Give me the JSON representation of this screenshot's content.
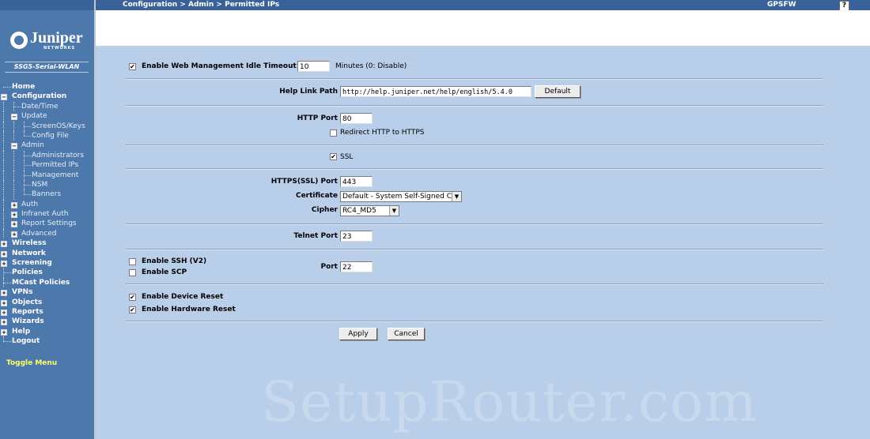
{
  "brand": {
    "logo_text": "Juniper",
    "logo_subtext": "NETWORKS",
    "device_name": "SSG5-Serial-WLAN"
  },
  "header": {
    "breadcrumb": "Configuration > Admin > Permitted IPs",
    "device_title": "GPSFW",
    "help_label": "?"
  },
  "nav": {
    "items": [
      {
        "label": "Home"
      },
      {
        "label": "Configuration"
      },
      {
        "label": "Date/Time"
      },
      {
        "label": "Update"
      },
      {
        "label": "ScreenOS/Keys"
      },
      {
        "label": "Config File"
      },
      {
        "label": "Admin"
      },
      {
        "label": "Administrators"
      },
      {
        "label": "Permitted IPs"
      },
      {
        "label": "Management"
      },
      {
        "label": "NSM"
      },
      {
        "label": "Banners"
      },
      {
        "label": "Auth"
      },
      {
        "label": "Infranet Auth"
      },
      {
        "label": "Report Settings"
      },
      {
        "label": "Advanced"
      },
      {
        "label": "Wireless"
      },
      {
        "label": "Network"
      },
      {
        "label": "Screening"
      },
      {
        "label": "Policies"
      },
      {
        "label": "MCast Policies"
      },
      {
        "label": "VPNs"
      },
      {
        "label": "Objects"
      },
      {
        "label": "Reports"
      },
      {
        "label": "Wizards"
      },
      {
        "label": "Help"
      },
      {
        "label": "Logout"
      }
    ],
    "toggle_menu": "Toggle Menu"
  },
  "form": {
    "idle_timeout": {
      "label": "Enable Web Management Idle Timeout",
      "checked": true,
      "value": "10",
      "unit": "Minutes (0: Disable)"
    },
    "help_link": {
      "label": "Help Link Path",
      "value": "http://help.juniper.net/help/english/5.4.0",
      "button": "Default"
    },
    "http_port": {
      "label": "HTTP Port",
      "value": "80",
      "redirect_label": "Redirect HTTP to HTTPS",
      "redirect_checked": false
    },
    "ssl": {
      "label": "SSL",
      "checked": true
    },
    "https_port": {
      "label": "HTTPS(SSL) Port",
      "value": "443"
    },
    "certificate": {
      "label": "Certificate",
      "value": "Default - System Self-Signed Cert"
    },
    "cipher": {
      "label": "Cipher",
      "value": "RC4_MD5"
    },
    "telnet_port": {
      "label": "Telnet Port",
      "value": "23"
    },
    "ssh": {
      "label": "Enable SSH (V2)",
      "checked": false
    },
    "scp": {
      "label": "Enable SCP",
      "checked": false
    },
    "ssh_port": {
      "label": "Port",
      "value": "22"
    },
    "device_reset": {
      "label": "Enable Device Reset",
      "checked": true
    },
    "hardware_reset": {
      "label": "Enable Hardware Reset",
      "checked": true
    },
    "apply_button": "Apply",
    "cancel_button": "Cancel",
    "check_mark": "✔"
  },
  "watermark": "SetupRouter.com"
}
